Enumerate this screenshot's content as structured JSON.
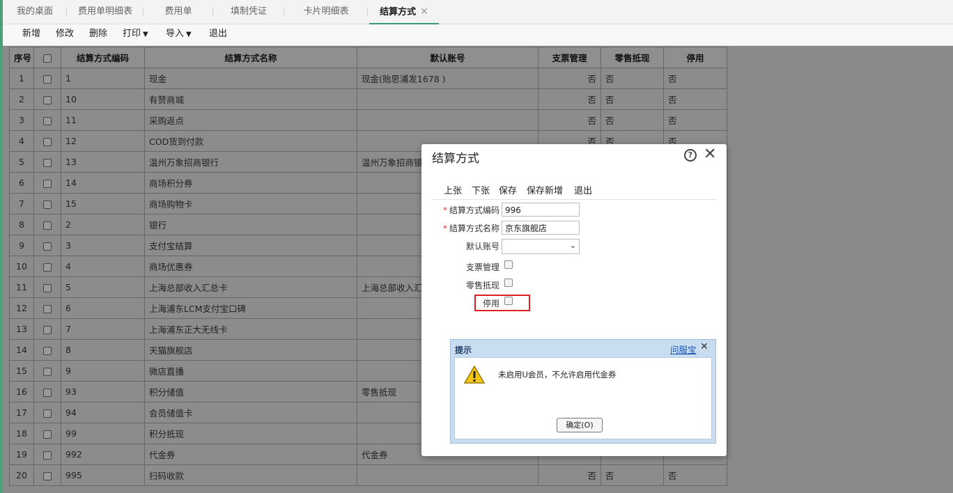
{
  "tabs": [
    {
      "label": "我的桌面"
    },
    {
      "label": "费用单明细表"
    },
    {
      "label": "费用单"
    },
    {
      "label": "填制凭证"
    },
    {
      "label": "卡片明细表"
    },
    {
      "label": "结算方式",
      "active": true
    }
  ],
  "toolbar": {
    "add": "新增",
    "edit": "修改",
    "delete": "删除",
    "print": "打印",
    "import": "导入",
    "exit": "退出"
  },
  "table": {
    "headers": {
      "index": "序号",
      "code": "结算方式编码",
      "name": "结算方式名称",
      "account": "默认账号",
      "cheque": "支票管理",
      "retail": "零售抵现",
      "disabled": "停用"
    },
    "rows": [
      {
        "no": "1",
        "code": "1",
        "name": "现金",
        "account": "现金(贻思浦发1678 )",
        "cheque": "否",
        "retail": "否",
        "disabled": "否"
      },
      {
        "no": "2",
        "code": "10",
        "name": "有赞商城",
        "account": "",
        "cheque": "否",
        "retail": "否",
        "disabled": "否"
      },
      {
        "no": "3",
        "code": "11",
        "name": "采购返点",
        "account": "",
        "cheque": "否",
        "retail": "否",
        "disabled": "否"
      },
      {
        "no": "4",
        "code": "12",
        "name": "COD货到付款",
        "account": "",
        "cheque": "否",
        "retail": "否",
        "disabled": "否"
      },
      {
        "no": "5",
        "code": "13",
        "name": "温州万象招商银行",
        "account": "温州万象招商银",
        "cheque": "",
        "retail": "",
        "disabled": ""
      },
      {
        "no": "6",
        "code": "14",
        "name": "商场积分券",
        "account": "",
        "cheque": "",
        "retail": "",
        "disabled": ""
      },
      {
        "no": "7",
        "code": "15",
        "name": "商场购物卡",
        "account": "",
        "cheque": "",
        "retail": "",
        "disabled": ""
      },
      {
        "no": "8",
        "code": "2",
        "name": "银行",
        "account": "",
        "cheque": "",
        "retail": "",
        "disabled": ""
      },
      {
        "no": "9",
        "code": "3",
        "name": "支付宝结算",
        "account": "",
        "cheque": "",
        "retail": "",
        "disabled": ""
      },
      {
        "no": "10",
        "code": "4",
        "name": "商场优惠券",
        "account": "",
        "cheque": "",
        "retail": "",
        "disabled": ""
      },
      {
        "no": "11",
        "code": "5",
        "name": "上海总部收入汇总卡",
        "account": "上海总部收入汇",
        "cheque": "",
        "retail": "",
        "disabled": ""
      },
      {
        "no": "12",
        "code": "6",
        "name": "上海浦东LCM支付宝口碑",
        "account": "",
        "cheque": "",
        "retail": "",
        "disabled": ""
      },
      {
        "no": "13",
        "code": "7",
        "name": "上海浦东正大无线卡",
        "account": "",
        "cheque": "",
        "retail": "",
        "disabled": ""
      },
      {
        "no": "14",
        "code": "8",
        "name": "天猫旗舰店",
        "account": "",
        "cheque": "",
        "retail": "",
        "disabled": ""
      },
      {
        "no": "15",
        "code": "9",
        "name": "微店直播",
        "account": "",
        "cheque": "",
        "retail": "",
        "disabled": ""
      },
      {
        "no": "16",
        "code": "93",
        "name": "积分储值",
        "account": "零售抵现",
        "cheque": "",
        "retail": "",
        "disabled": ""
      },
      {
        "no": "17",
        "code": "94",
        "name": "会员储值卡",
        "account": "",
        "cheque": "",
        "retail": "",
        "disabled": ""
      },
      {
        "no": "18",
        "code": "99",
        "name": "积分抵现",
        "account": "",
        "cheque": "",
        "retail": "",
        "disabled": ""
      },
      {
        "no": "19",
        "code": "992",
        "name": "代金券",
        "account": "代金券",
        "cheque": "",
        "retail": "",
        "disabled": ""
      },
      {
        "no": "20",
        "code": "995",
        "name": "扫码收款",
        "account": "",
        "cheque": "否",
        "retail": "否",
        "disabled": "否"
      }
    ]
  },
  "dialog": {
    "title": "结算方式",
    "toolbar": {
      "prev": "上张",
      "next": "下张",
      "save": "保存",
      "save_new": "保存新增",
      "exit": "退出"
    },
    "fields": {
      "code_label": "结算方式编码",
      "code_value": "996",
      "name_label": "结算方式名称",
      "name_value": "京东旗舰店",
      "account_label": "默认账号",
      "cheque_label": "支票管理",
      "retail_label": "零售抵现",
      "disabled_label": "停用"
    }
  },
  "alert": {
    "title": "提示",
    "link": "问服宝",
    "message": "未启用U会员，不允许启用代金券",
    "ok": "确定(O)"
  },
  "colors": {
    "accent": "#3a9d6e",
    "highlight": "#e02020",
    "alert_bg": "#c8ddf0"
  }
}
